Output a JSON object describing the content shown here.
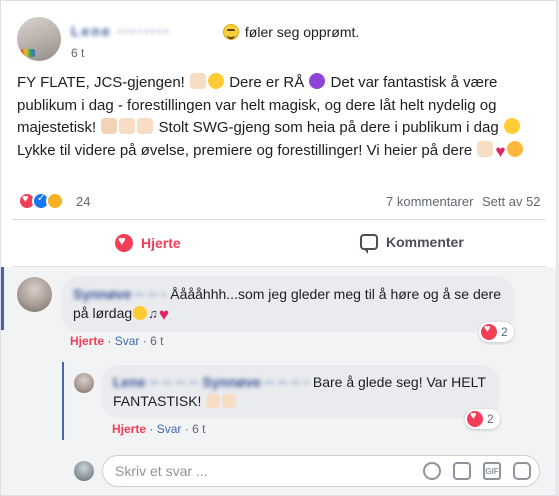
{
  "post": {
    "author": "Lene ········",
    "feeling": "føler seg opprømt.",
    "time": "6 t",
    "text_parts": [
      "FY FLATE, JCS-gjengen! ",
      " Dere er RÅ ",
      " Det var fantastisk å være publikum i dag - forestillingen var helt magisk, og dere låt helt nydelig og majestetisk! ",
      " Stolt SWG-gjeng som heia på dere i publikum i dag ",
      " Lykke til videre på øvelse, premiere og forestillinger! Vi heier på dere "
    ],
    "reaction_count": "24",
    "comments_count": "7 kommentarer",
    "seen_count": "Sett av 52",
    "actions": {
      "love": "Hjerte",
      "comment": "Kommenter"
    }
  },
  "comments": [
    {
      "author": "Synnøve ·· ·· ·",
      "text_a": " Ååååhhh...som jeg gleder meg til å høre og å se dere på lørdag",
      "meta_love": "Hjerte",
      "meta_reply": "Svar",
      "meta_time": "6 t",
      "react_count": "2"
    },
    {
      "author": "Lene ·· ·· ·· ·· Synnøve ·· ·· ·· ·",
      "text": " Bare å glede seg! Var HELT FANTASTISK! ",
      "meta_love": "Hjerte",
      "meta_reply": "Svar",
      "meta_time": "6 t",
      "react_count": "2"
    }
  ],
  "composer": {
    "placeholder": "Skriv et svar ..."
  },
  "colors": {
    "accent": "#4267b2",
    "love": "#f33e58",
    "link": "#385898"
  }
}
